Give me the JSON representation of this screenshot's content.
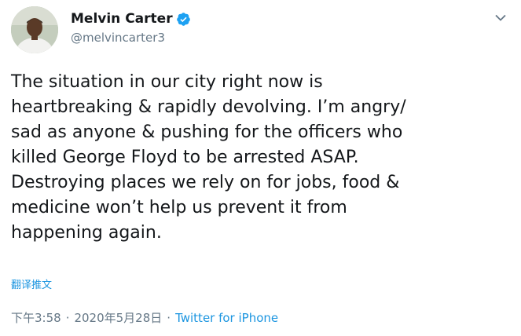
{
  "author": {
    "display_name": "Melvin Carter",
    "handle": "@melvincarter3",
    "verified": true
  },
  "tweet": {
    "text": "The situation in our city right now is\nheartbreaking & rapidly devolving. I’m angry/\nsad as anyone & pushing for the officers who\nkilled George Floyd to be arrested ASAP.\nDestroying places we rely on for jobs, food &\nmedicine won’t help us prevent it from\nhappening again.",
    "translate_label": "翻译推文",
    "time": "下午3:58",
    "date": "2020年5月28日",
    "separator": "·",
    "source": "Twitter for iPhone"
  },
  "icons": {
    "verified": "verified-badge-icon",
    "caret": "chevron-down-icon",
    "avatar": "avatar"
  },
  "colors": {
    "link": "#1b95e0",
    "secondary_text": "#657786",
    "primary_text": "#14171a",
    "verified": "#1da1f2"
  }
}
